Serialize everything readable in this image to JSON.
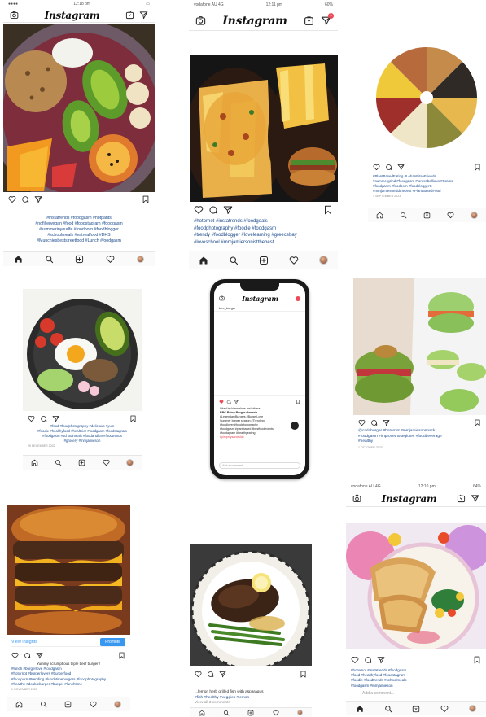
{
  "colors": {
    "link_blue": "#1b4a8c",
    "like_red": "#ed4956",
    "promote_blue": "#3897f0"
  },
  "icons": [
    "camera-icon",
    "igtv-icon",
    "direct-icon",
    "heart-icon",
    "comment-icon",
    "share-icon",
    "bookmark-icon",
    "home-icon",
    "search-icon",
    "add-post-icon",
    "activity-icon",
    "profile-avatar"
  ],
  "panel1": {
    "status_time": "12:18 pm",
    "logo": "Instagram",
    "caption": [
      "#instatrends #foodgasm #hotpants",
      "#nofiltervegan #food #foodstagram #foodgasm",
      "#summerinyourlfe #foodporn #foodblogger",
      "#schoolmeals #eatrealfood #DHS",
      "#Munchiesbeststreetfood #Lunch #foodgasm"
    ]
  },
  "panel2": {
    "status_carrier": "vodafone AU  4G",
    "status_time": "12:11 pm",
    "status_battery": "60%",
    "logo": "Instagram",
    "badge": "1",
    "more": "...",
    "caption": [
      "#hotornot #instatrends #foodgoals",
      "#foodphotography #foodie #foodgasm",
      "#trendy #foodblogger #loveleaming #greecebay",
      "#loveschool #mmjamiersonistthebest"
    ]
  },
  "panel3": {
    "caption": [
      "#PlantBasedEating #LebanBitsoFriends",
      "#summergrind #foodgasm #tonyrebellious #Grains",
      "#foodgasm #foodporn #foodbloggerS",
      "#mmjamiesonsidthebest #PlantBasedFood"
    ],
    "date": "1 SEPTEMBER 2023"
  },
  "panel4": {
    "caption": [
      "#food #foodphotography #delicious #yum",
      "#foodie #healthyfood #healthier #foodgasm #foodstagram",
      "#foodgasm #schoolmeals #foodandfun #foodtrends",
      "#grocery #mmjamieson"
    ],
    "date": "25 DECEMBER 2022"
  },
  "panel5": {
    "logo": "Instagram",
    "user": "bee_burger",
    "caption": [
      "Liked by kiannalove and others",
      "BBC Rainy Burger Genesis",
      "#LegendaryBurgers #BurgerLove",
      "Summer burger season #Trending",
      "#foodlover #foodphotography",
      "#foodgasm #plantbased #bestfoodevents",
      "#foodagram #healthyeating",
      "#pimpmysandwich"
    ],
    "comment_placeholder": "Add a comment..."
  },
  "panel6": {
    "caption": [
      "@cadoburger #hotornot #mmjamiesonsnack",
      "#foodgasm #improvethoseglutes #foodbeverage",
      "#healthy"
    ],
    "date": "1 OCTOBER 2023"
  },
  "panel7": {
    "insights": "View insights",
    "promote": "Promote",
    "caption": [
      "Yummy scrumptious triple beef burger !",
      "#lunch #burgerlove #foodgasm",
      "#hotornot #burgerlovers #burgerfood",
      "#foodporn #trending #lunchtimeburgers #foodphotography",
      "#healthy #doubleburger #burger #lunchtime"
    ],
    "date": "1 NOVEMBER 2023"
  },
  "panel8": {
    "caption": [
      "...lemon herb grilled fish with asparagus",
      "#fish #healthy #veggies #lemon"
    ],
    "comments": "View all 3 comments"
  },
  "panel9": {
    "status_carrier": "vodafone AU  4G",
    "status_time": "12:10 pm",
    "status_battery": "64%",
    "logo": "Instagram",
    "more": "...",
    "caption": [
      "#hotornot #instatrends #foodgasm",
      "#food #healthyfood #foodstagram",
      "#foodie #foodtrends #schoolmeals",
      "#foodgasm #mmjamieson"
    ],
    "comment_placeholder": "Add a comment..."
  }
}
